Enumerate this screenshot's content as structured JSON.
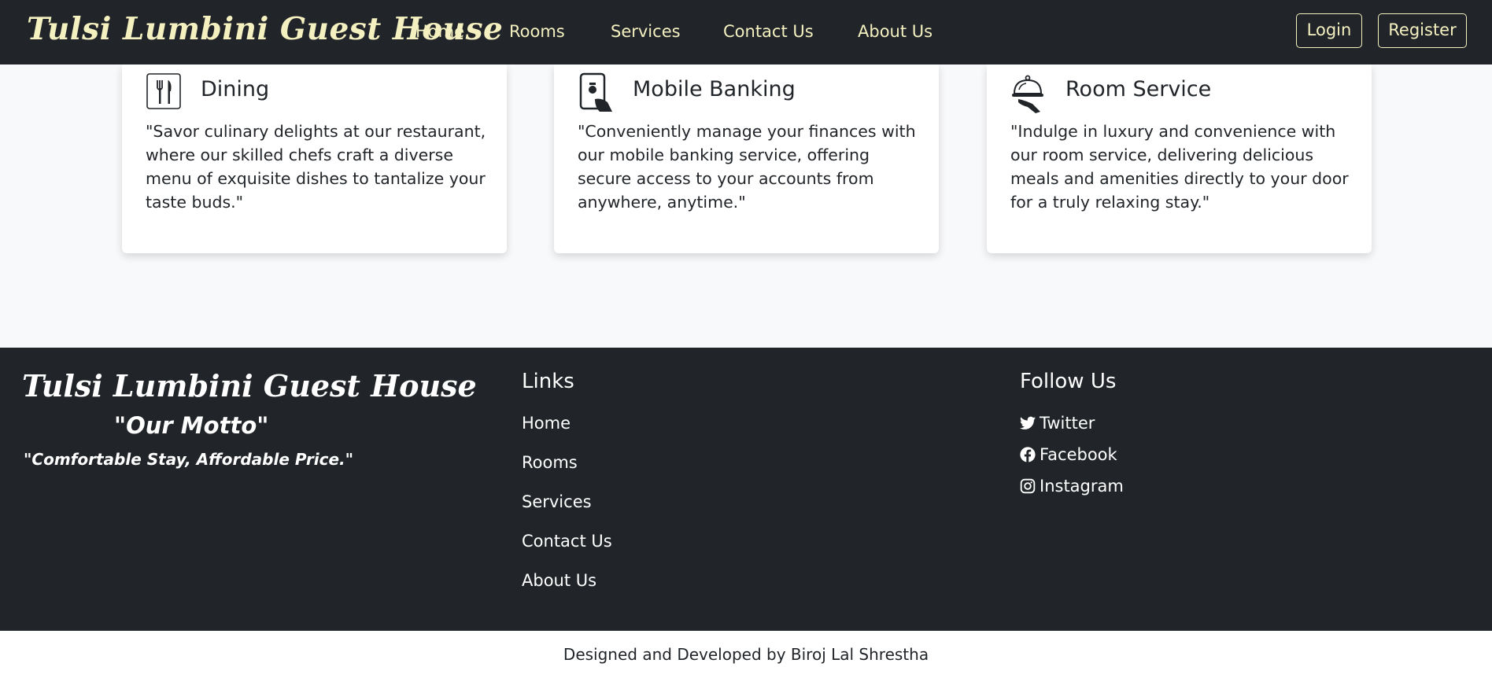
{
  "navbar": {
    "brand": "Tulsi Lumbini Guest House",
    "links": [
      "Home",
      "Rooms",
      "Services",
      "Contact Us",
      "About Us"
    ],
    "login_label": "Login",
    "register_label": "Register"
  },
  "services": [
    {
      "icon": "fork-knife-icon",
      "title": "Dining",
      "text": "\"Savor culinary delights at our restaurant, where our skilled chefs craft a diverse menu of exquisite dishes to tantalize your taste buds.\""
    },
    {
      "icon": "mobile-banking-icon",
      "title": "Mobile Banking",
      "text": "\"Conveniently manage your finances with our mobile banking service, offering secure access to your accounts from anywhere, anytime.\""
    },
    {
      "icon": "room-service-icon",
      "title": "Room Service",
      "text": "\"Indulge in luxury and convenience with our room service, delivering delicious meals and amenities directly to your door for a truly relaxing stay.\""
    }
  ],
  "footer": {
    "brand": "Tulsi Lumbini Guest House",
    "motto_title": "\"Our Motto\"",
    "motto": "\"Comfortable Stay, Affordable Price.\"",
    "links_heading": "Links",
    "links": [
      "Home",
      "Rooms",
      "Services",
      "Contact Us",
      "About Us"
    ],
    "follow_heading": "Follow Us",
    "social": [
      {
        "icon": "twitter-icon",
        "label": "Twitter"
      },
      {
        "icon": "facebook-icon",
        "label": "Facebook"
      },
      {
        "icon": "instagram-icon",
        "label": "Instagram"
      }
    ]
  },
  "credit": "Designed and Developed by Biroj Lal Shrestha",
  "colors": {
    "dark": "#212529",
    "accent_cream": "#f4f0c0",
    "page_bg": "#f8f9fa",
    "card_bg": "#ffffff"
  }
}
